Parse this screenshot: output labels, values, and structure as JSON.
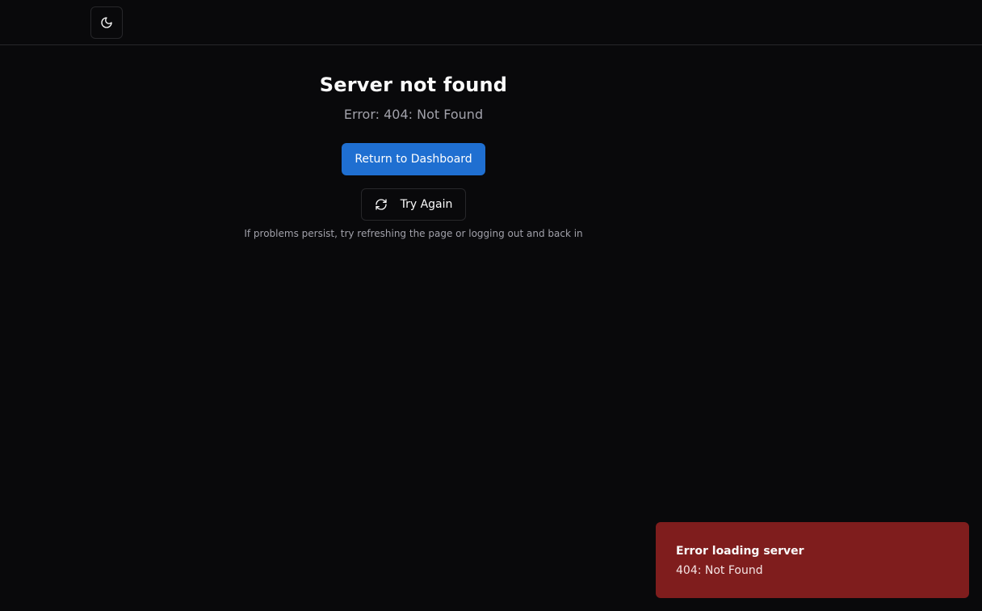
{
  "header": {
    "theme_toggle_icon": "moon-icon"
  },
  "main": {
    "title": "Server not found",
    "error_message": "Error: 404: Not Found",
    "return_button_label": "Return to Dashboard",
    "retry_button_label": "Try Again",
    "retry_icon": "refresh-icon",
    "hint": "If problems persist, try refreshing the page or logging out and back in"
  },
  "toast": {
    "title": "Error loading server",
    "description": "404: Not Found"
  },
  "colors": {
    "background": "#09090b",
    "primary_button": "#1f6fd1",
    "toast_background": "#7f1d1d",
    "border": "#27272a",
    "muted_text": "#a1a1aa"
  }
}
